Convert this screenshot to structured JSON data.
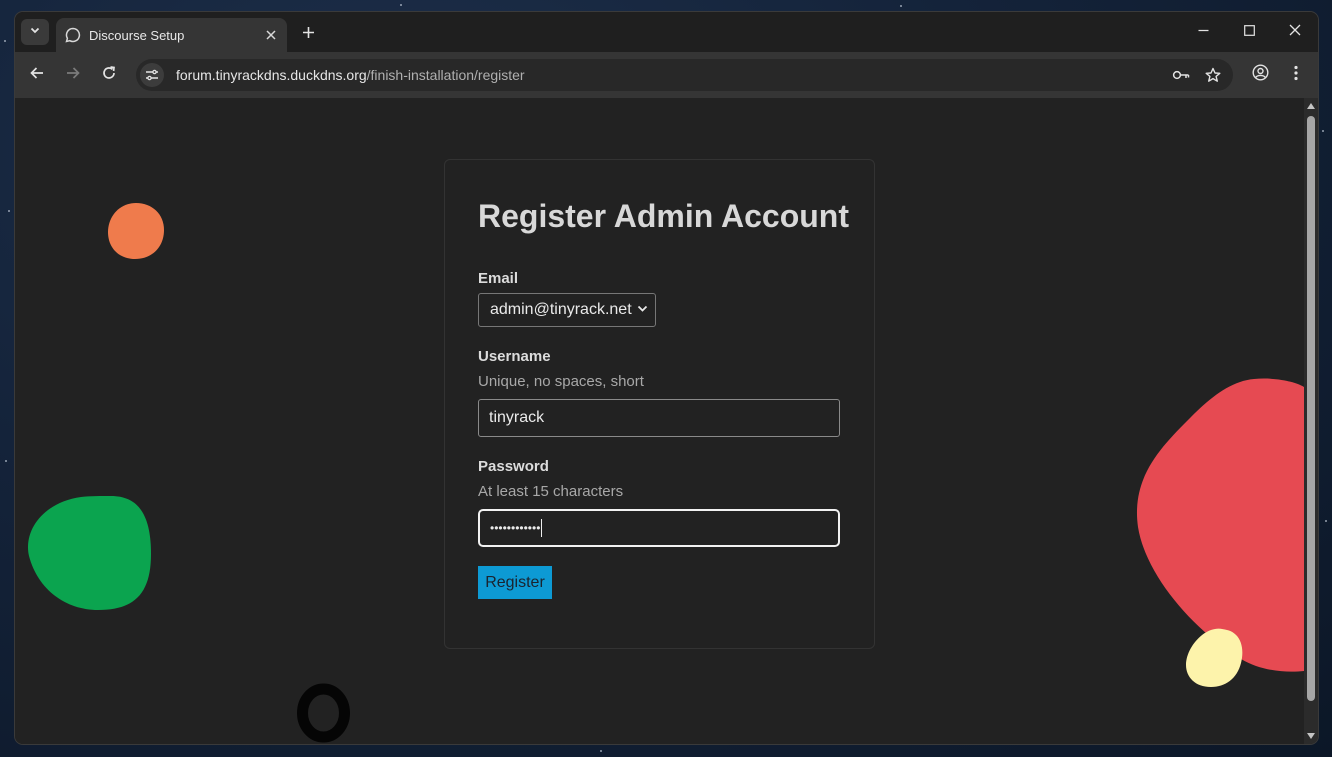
{
  "browser": {
    "tab": {
      "title": "Discourse Setup"
    },
    "url": {
      "host": "forum.tinyrackdns.duckdns.org",
      "path": "/finish-installation/register"
    }
  },
  "page": {
    "heading": "Register Admin Account",
    "email": {
      "label": "Email",
      "selected": "admin@tinyrack.net"
    },
    "username": {
      "label": "Username",
      "hint": "Unique, no spaces, short",
      "value": "tinyrack"
    },
    "password": {
      "label": "Password",
      "hint": "At least 15 characters",
      "masked_value": "••••••••••••"
    },
    "submit_label": "Register"
  },
  "colors": {
    "accent": "#0d9ad4",
    "blob_orange": "#ef7b4c",
    "blob_green": "#0ba44f",
    "blob_red": "#e64a52",
    "blob_yellow": "#fdf3ab",
    "blob_black": "#050505"
  },
  "icons": {
    "tab_search": "chevron-down-icon",
    "favicon": "discourse-logo-icon",
    "tab_close": "close-icon",
    "new_tab": "plus-icon",
    "back": "arrow-left-icon",
    "forward": "arrow-right-icon",
    "reload": "reload-icon",
    "site_info": "tune-icon",
    "password_manager": "key-icon",
    "bookmark": "star-icon",
    "profile": "account-icon",
    "menu": "kebab-menu-icon"
  }
}
